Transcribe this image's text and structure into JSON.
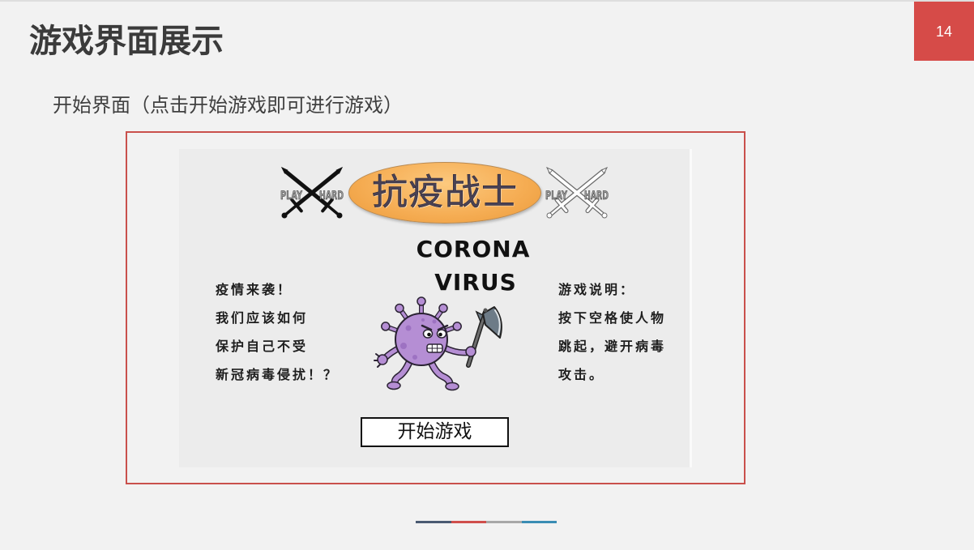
{
  "slide": {
    "title": "游戏界面展示",
    "page_number": "14",
    "subtitle": "开始界面（点击开始游戏即可进行游戏）"
  },
  "game_screen": {
    "title": "抗疫战士",
    "left_badge": {
      "icon": "crossed-swords-icon",
      "word_left": "PLAY",
      "word_right": "HARD"
    },
    "right_badge": {
      "icon": "crossed-swords-icon",
      "word_left": "PLAY",
      "word_right": "HARD"
    },
    "virus_caption": [
      "CORONA",
      "VIRUS"
    ],
    "mascot_icon": "virus-mascot-with-axe-icon",
    "story_lines": [
      "疫情来袭！",
      "我们应该如何",
      "保护自己不受",
      "新冠病毒侵扰！？"
    ],
    "instruction_lines": [
      "游戏说明：",
      "按下空格使人物",
      "跳起，避开病毒",
      "攻击。"
    ],
    "start_button_label": "开始游戏"
  },
  "colors": {
    "slide_background": "#f2f2f2",
    "accent": "#d64b48",
    "frame_border": "#c9504c",
    "text": "#404040",
    "game_background": "#ececec",
    "title_ellipse": "#f5ac52",
    "virus_body": "#b58ed4",
    "footer_bar": [
      "#4a5a72",
      "#d04f4c",
      "#a8a8a8",
      "#3a8db4"
    ]
  }
}
